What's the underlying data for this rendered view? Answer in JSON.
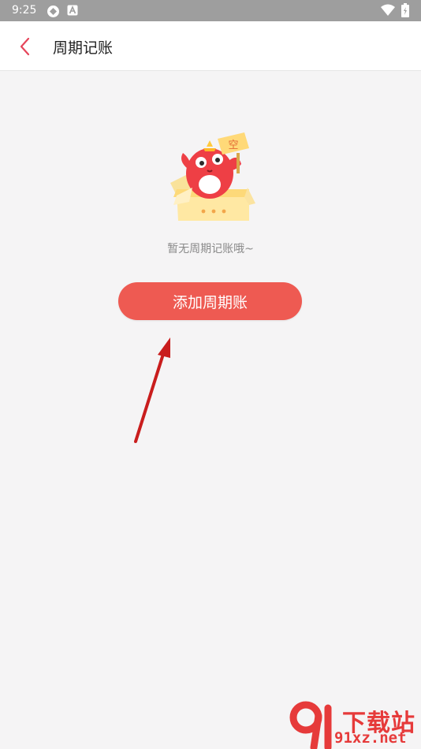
{
  "status_bar": {
    "time": "9:25",
    "icons": [
      "circle-app-icon",
      "font-a-icon",
      "wifi-icon",
      "battery-icon"
    ]
  },
  "app_bar": {
    "back_icon": "chevron-left-icon",
    "title": "周期记账"
  },
  "empty_state": {
    "illustration": "empty-box-mascot",
    "sign_text": "空",
    "message": "暂无周期记账哦~"
  },
  "primary_action": {
    "label": "添加周期账"
  },
  "annotation": {
    "icon": "red-arrow"
  },
  "watermark": {
    "logo": "91-logo",
    "line1": "下载站",
    "line2": "91xz.net"
  },
  "colors": {
    "accent": "#ee5a52",
    "back_chevron": "#e6455a",
    "status_bar": "#9e9e9e",
    "background": "#f5f4f5"
  }
}
